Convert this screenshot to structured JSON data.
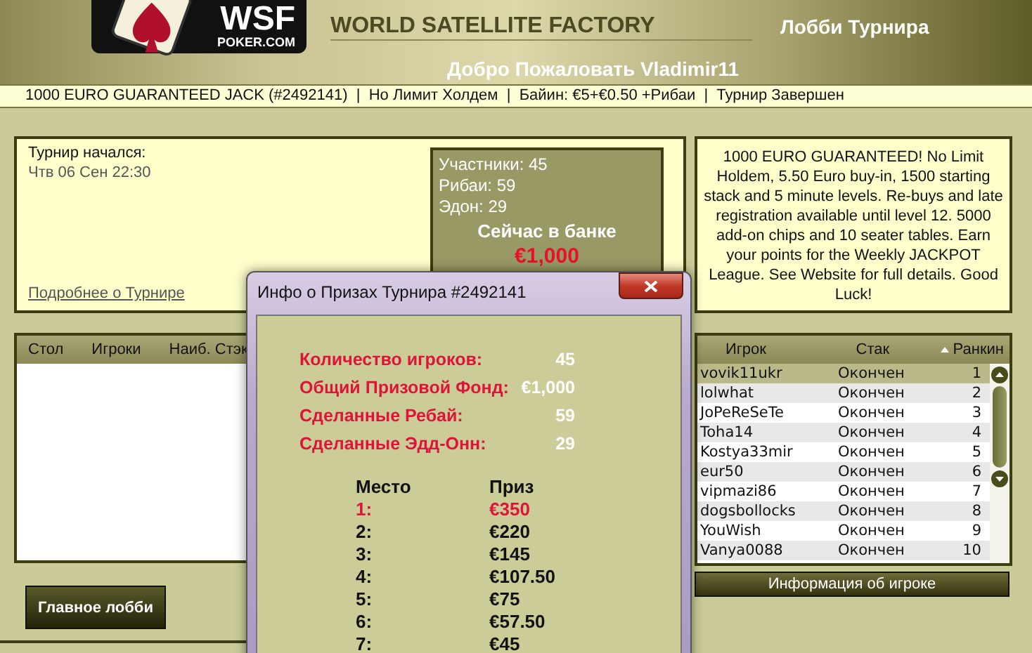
{
  "header": {
    "logo_text": "WSF",
    "logo_sub": "POKER.COM",
    "site_title": "WORLD SATELLITE FACTORY",
    "page_title": "Лобби Турнира",
    "welcome": "Добро Пожаловать Vladimir11"
  },
  "info_bar": "1000 EURO GUARANTEED JACK (#2492141)  |  Но Лимит Холдем  |  Байин: €5+€0.50 +Рибаи  |  Турнир Завершен",
  "tournament": {
    "started_label": "Турнир начался:",
    "started_value": "Чтв 06 Сен 22:30",
    "details_link": "Подробнее о Турнире",
    "stats": [
      "Участники: 45",
      "Рибаи: 59",
      "Эдон: 29"
    ],
    "pot_label": "Сейчас в банке",
    "pot_value": "€1,000"
  },
  "description": "1000 EURO GUARANTEED! No Limit Holdem, 5.50 Euro buy-in, 1500 starting stack and 5 minute levels. Re-buys and late registration available until level 12. 5000 add-on chips and 10 seater tables. Earn your points for the Weekly JACKPOT League. See Website for full details. Good Luck!",
  "tables": {
    "columns": [
      "Стол",
      "Игроки",
      "Наиб. Стэк"
    ]
  },
  "main_lobby_button": "Главное лобби",
  "players": {
    "columns": [
      {
        "label": "Игрок",
        "sorted": false
      },
      {
        "label": "Стак",
        "sorted": false
      },
      {
        "label": "Ранкин",
        "sorted": true
      }
    ],
    "rows": [
      {
        "name": "vovik11ukr",
        "stack": "Окончен",
        "rank": "1",
        "selected": true
      },
      {
        "name": "lolwhat",
        "stack": "Окончен",
        "rank": "2",
        "selected": false
      },
      {
        "name": "JoPeReSeTe",
        "stack": "Окончен",
        "rank": "3",
        "selected": false
      },
      {
        "name": "Toha14",
        "stack": "Окончен",
        "rank": "4",
        "selected": false
      },
      {
        "name": "Kostya33mir",
        "stack": "Окончен",
        "rank": "5",
        "selected": false
      },
      {
        "name": "eur50",
        "stack": "Окончен",
        "rank": "6",
        "selected": false
      },
      {
        "name": "vipmazi86",
        "stack": "Окончен",
        "rank": "7",
        "selected": false
      },
      {
        "name": "dogsbollocks",
        "stack": "Окончен",
        "rank": "8",
        "selected": false
      },
      {
        "name": "YouWish",
        "stack": "Окончен",
        "rank": "9",
        "selected": false
      },
      {
        "name": "Vanya0088",
        "stack": "Окончен",
        "rank": "10",
        "selected": false
      }
    ]
  },
  "player_info_button": "Информация об игроке",
  "dialog": {
    "title": "Инфо о Призах Турнира #2492141",
    "summary": [
      {
        "label": "Количество игроков:",
        "value": "45"
      },
      {
        "label": "Общий Призовой Фонд:",
        "value": "€1,000"
      },
      {
        "label": "Сделанные Ребай:",
        "value": "59"
      },
      {
        "label": "Сделанные Эдд-Онн:",
        "value": "29"
      }
    ],
    "prize_columns": [
      "Место",
      "Приз"
    ],
    "prizes": [
      {
        "place": "1:",
        "prize": "€350",
        "highlighted": true
      },
      {
        "place": "2:",
        "prize": "€220",
        "highlighted": false
      },
      {
        "place": "3:",
        "prize": "€145",
        "highlighted": false
      },
      {
        "place": "4:",
        "prize": "€107.50",
        "highlighted": false
      },
      {
        "place": "5:",
        "prize": "€75",
        "highlighted": false
      },
      {
        "place": "6:",
        "prize": "€57.50",
        "highlighted": false
      },
      {
        "place": "7:",
        "prize": "€45",
        "highlighted": false
      }
    ]
  }
}
